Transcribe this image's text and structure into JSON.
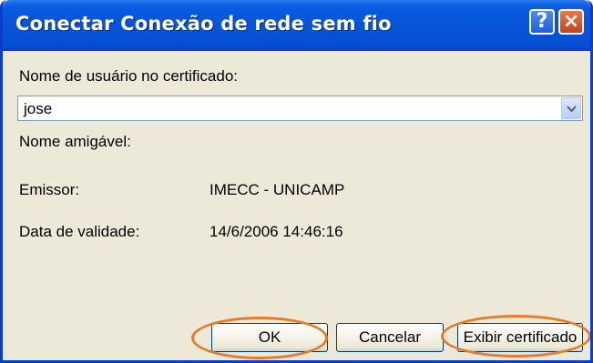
{
  "window": {
    "title": "Conectar Conexão de rede sem fio",
    "help_icon": "?",
    "close_icon": "×"
  },
  "form": {
    "username_label": "Nome de usuário no certificado:",
    "username_value": "jose",
    "friendly_name_label": "Nome amigável:",
    "issuer_label": "Emissor:",
    "issuer_value": "IMECC - UNICAMP",
    "expiry_label": "Data de validade:",
    "expiry_value": "14/6/2006 14:46:16"
  },
  "buttons": {
    "ok": "OK",
    "cancel": "Cancelar",
    "view_certificate": "Exibir certificado"
  },
  "colors": {
    "titlebar": "#0654d8",
    "dialog_bg": "#ece9d8",
    "highlight": "#ec7a25"
  }
}
